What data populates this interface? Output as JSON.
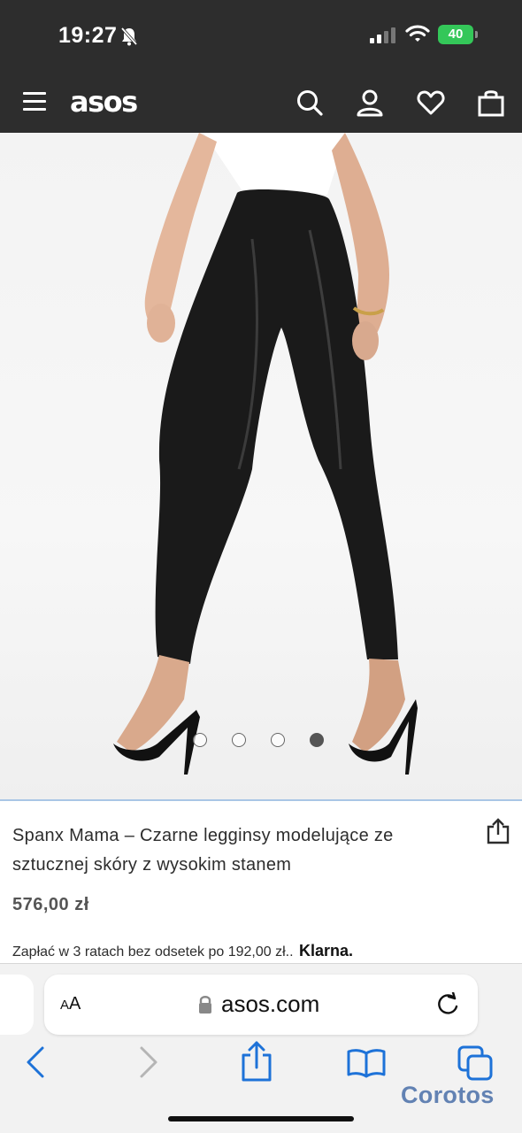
{
  "status_bar": {
    "time": "19:27",
    "battery": "40",
    "icons": [
      "bell-off-icon",
      "cellular-signal-icon",
      "wifi-icon",
      "battery-icon"
    ]
  },
  "header": {
    "logo": "asos",
    "icons": [
      "menu-icon",
      "search-icon",
      "account-icon",
      "wishlist-heart-icon",
      "bag-icon"
    ]
  },
  "product": {
    "image_alt_icon": "product-photo",
    "carousel": {
      "count": 4,
      "active_index": 3
    },
    "title": "Spanx Mama – Czarne legginsy modelujące ze sztucznej skóry z wysokim stanem",
    "price": "576,00 zł",
    "installments_text": "Zapłać w 3 ratach bez odsetek po 192,00 zł..",
    "klarna_label": "Klarna."
  },
  "browser": {
    "text_size_label_small": "A",
    "text_size_label_large": "A",
    "url": "asos.com",
    "icons": [
      "lock-icon",
      "reload-icon",
      "back-icon",
      "forward-icon",
      "share-icon",
      "bookmarks-icon",
      "tabs-icon"
    ]
  },
  "watermark": "Corotos",
  "colors": {
    "header_bg": "#2d2d2d",
    "battery": "#34c759",
    "browser_icon": "#1d72d8",
    "watermark": "#4a6fa9"
  }
}
